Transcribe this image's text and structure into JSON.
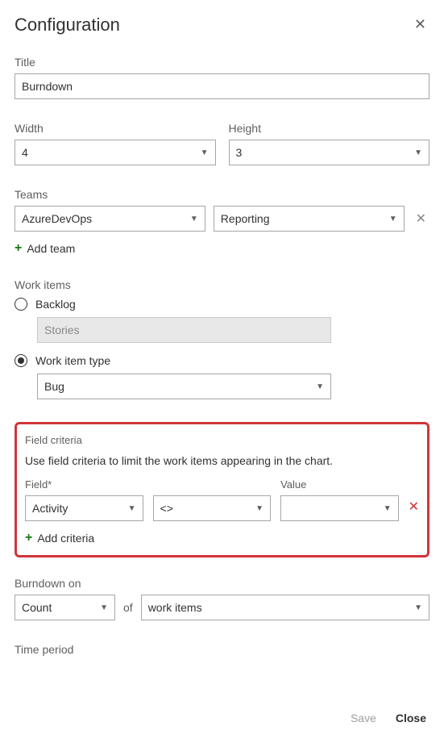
{
  "header": {
    "title": "Configuration"
  },
  "title": {
    "label": "Title",
    "value": "Burndown"
  },
  "width": {
    "label": "Width",
    "value": "4"
  },
  "height": {
    "label": "Height",
    "value": "3"
  },
  "teams": {
    "label": "Teams",
    "team1": "AzureDevOps",
    "team2": "Reporting",
    "add_label": "Add team"
  },
  "workitems": {
    "label": "Work items",
    "backlog_label": "Backlog",
    "backlog_value": "Stories",
    "type_label": "Work item type",
    "type_value": "Bug"
  },
  "criteria": {
    "section_label": "Field criteria",
    "description": "Use field criteria to limit the work items appearing in the chart.",
    "field_label": "Field*",
    "value_label": "Value",
    "field_value": "Activity",
    "operator_value": "<>",
    "value_value": "",
    "add_label": "Add criteria"
  },
  "burndown": {
    "label": "Burndown on",
    "count": "Count",
    "of": "of",
    "items": "work items"
  },
  "timeperiod": {
    "label": "Time period"
  },
  "footer": {
    "save": "Save",
    "close": "Close"
  }
}
